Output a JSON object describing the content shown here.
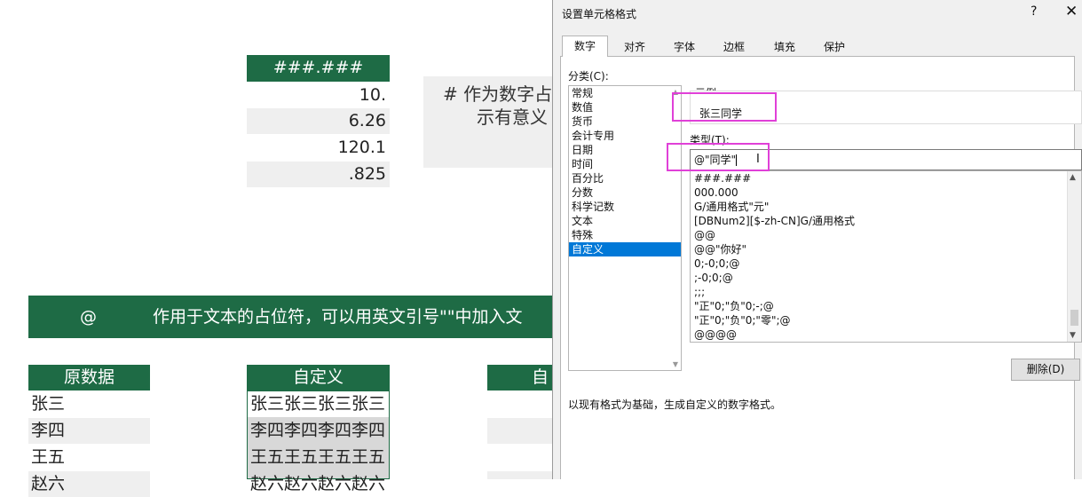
{
  "sheet": {
    "format_header": "###.###",
    "format_values": [
      "10.",
      "6.26",
      "120.1",
      ".825"
    ],
    "note_line1": "# 作为数字占",
    "note_line2": "示有意义",
    "banner_symbol": "@",
    "banner_text": "作用于文本的占位符，可以用英文引号\"\"中加入文",
    "col_original": "原数据",
    "col_custom": "自定义",
    "col_custom2": "自",
    "original_data": [
      "张三",
      "李四",
      "王五",
      "赵六"
    ],
    "custom_data": [
      "张三张三张三张三",
      "李四李四李四李四",
      "王五王五王五王五",
      "赵六赵六赵六赵六"
    ]
  },
  "dialog": {
    "title": "设置单元格格式",
    "help": "?",
    "close": "✕",
    "tabs": [
      "数字",
      "对齐",
      "字体",
      "边框",
      "填充",
      "保护"
    ],
    "active_tab": "数字",
    "category_label": "分类(C):",
    "categories": [
      "常规",
      "数值",
      "货币",
      "会计专用",
      "日期",
      "时间",
      "百分比",
      "分数",
      "科学记数",
      "文本",
      "特殊",
      "自定义"
    ],
    "selected_category": "自定义",
    "sample_label": "示例",
    "sample_value": "张三同学",
    "type_label": "类型(T):",
    "type_value": "@\"同学\"",
    "formats": [
      "###.###",
      "000.000",
      "G/通用格式\"元\"",
      "[DBNum2][$-zh-CN]G/通用格式",
      "@@",
      "@@\"你好\"",
      "0;-0;0;@",
      ";-0;0;@",
      ";;;",
      "\"正\"0;\"负\"0;-;@",
      "\"正\"0;\"负\"0;\"零\";@",
      "@@@@"
    ],
    "delete_label": "删除(D)",
    "description": "以现有格式为基础，生成自定义的数字格式。",
    "highlight_color": "#e040d8",
    "accent_color": "#1e6b45",
    "selection_color": "#0078d7"
  }
}
